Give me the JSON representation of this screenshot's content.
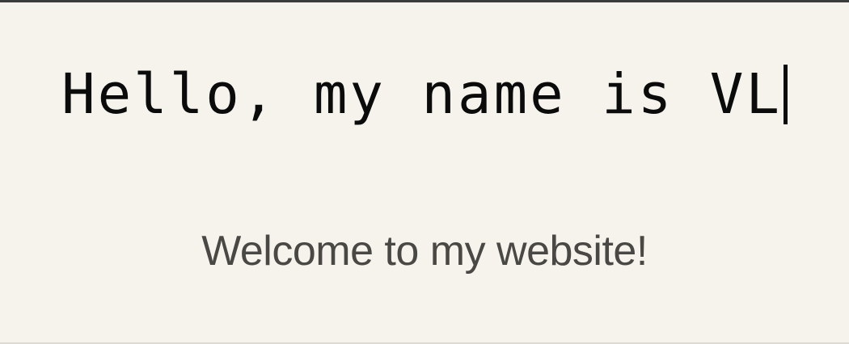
{
  "hero": {
    "headline": "Hello, my name is VL",
    "tagline": "Welcome to my website!"
  },
  "colors": {
    "background": "#f5f3eb",
    "headline": "#0b0b0b",
    "tagline": "#4a4845",
    "top_rule": "#3b3b3b"
  }
}
